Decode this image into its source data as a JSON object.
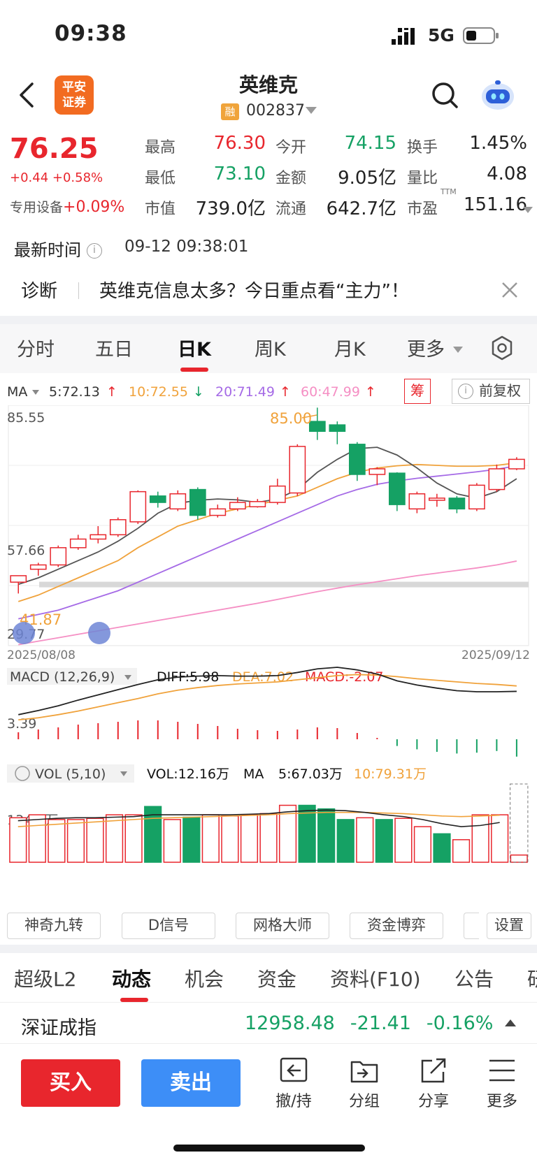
{
  "status": {
    "time": "09:38",
    "network": "5G"
  },
  "header": {
    "logo_line1": "平安",
    "logo_line2": "证券",
    "name": "英维克",
    "badge": "融",
    "code": "002837"
  },
  "quote": {
    "price": "76.25",
    "change": "+0.44 +0.58%",
    "sector": "专用设备",
    "sector_change": "+0.09%",
    "high_label": "最高",
    "high": "76.30",
    "open_label": "今开",
    "open": "74.15",
    "turnover_label": "换手",
    "turnover": "1.45%",
    "low_label": "最低",
    "low": "73.10",
    "amount_label": "金额",
    "amount": "9.05亿",
    "vol_ratio_label": "量比",
    "vol_ratio": "4.08",
    "mktcap_label": "市值",
    "mktcap": "739.0亿",
    "float_label": "流通",
    "float": "642.7亿",
    "pe_label": "市盈",
    "pe_mark": "TTM",
    "pe": "151.16"
  },
  "update": {
    "label": "最新时间",
    "time": "09-12 09:38:01"
  },
  "diagnosis": {
    "label": "诊断",
    "text": "英维克信息太多？今日重点看“主力”！"
  },
  "period_tabs": [
    "分时",
    "五日",
    "日K",
    "周K",
    "月K",
    "更多"
  ],
  "ma_bar": {
    "label": "MA",
    "ma5": "5:72.13",
    "ma10": "10:72.55",
    "ma20": "20:71.49",
    "ma60": "60:47.99",
    "chip_label": "筹",
    "adjust_label": "前复权"
  },
  "chart_data": {
    "type": "candlestick",
    "y_labels": [
      "85.55",
      "57.66",
      "29.77"
    ],
    "high_annotation": "85.00",
    "low_annotation": "41.87",
    "x_start": "2025/08/08",
    "x_end": "2025/09/12",
    "ylim": [
      29.77,
      85.55
    ],
    "candles": [
      [
        44.5,
        46.0,
        41.87,
        42.5
      ],
      [
        47.5,
        48.5,
        46.0,
        49.0
      ],
      [
        48.5,
        52.5,
        48.0,
        53.0
      ],
      [
        52.5,
        54.5,
        52.0,
        55.5
      ],
      [
        54.5,
        55.5,
        53.5,
        57.5
      ],
      [
        55.5,
        59.0,
        55.0,
        59.5
      ],
      [
        58.5,
        65.5,
        58.0,
        65.8
      ],
      [
        64.5,
        63.0,
        61.8,
        65.5
      ],
      [
        61.5,
        65.0,
        61.0,
        65.8
      ],
      [
        66.0,
        60.0,
        59.0,
        66.5
      ],
      [
        60.0,
        61.5,
        59.5,
        62.5
      ],
      [
        61.5,
        63.0,
        61.0,
        64.2
      ],
      [
        62.0,
        63.2,
        61.8,
        63.8
      ],
      [
        63.0,
        66.8,
        62.5,
        68.5
      ],
      [
        65.2,
        76.0,
        64.5,
        76.5
      ],
      [
        81.8,
        79.5,
        77.5,
        85.0
      ],
      [
        81.0,
        79.5,
        76.5,
        81.8
      ],
      [
        76.5,
        69.5,
        68.0,
        77.0
      ],
      [
        69.5,
        70.8,
        67.0,
        71.2
      ],
      [
        69.8,
        62.5,
        61.0,
        70.0
      ],
      [
        61.5,
        65.0,
        60.5,
        65.5
      ],
      [
        63.5,
        64.0,
        62.0,
        65.0
      ],
      [
        64.0,
        61.5,
        60.5,
        64.5
      ],
      [
        61.5,
        67.0,
        61.0,
        67.5
      ],
      [
        66.0,
        70.8,
        65.5,
        71.8
      ],
      [
        70.8,
        73.0,
        70.5,
        73.5
      ]
    ],
    "ma5": [
      44.0,
      45.5,
      47.5,
      49.5,
      51.5,
      54.0,
      57.0,
      60.5,
      62.8,
      63.5,
      63.8,
      63.6,
      63.0,
      63.8,
      66.0,
      70.0,
      73.0,
      75.5,
      75.8,
      74.0,
      71.0,
      67.5,
      65.0,
      64.0,
      65.5,
      68.5
    ],
    "ma10": [
      40.0,
      41.5,
      43.5,
      45.5,
      47.5,
      49.5,
      52.5,
      55.0,
      57.5,
      59.0,
      60.5,
      61.5,
      62.5,
      63.5,
      64.5,
      66.5,
      68.5,
      70.0,
      71.0,
      71.5,
      71.8,
      71.6,
      71.4,
      71.4,
      71.6,
      72.2
    ],
    "ma20": [
      36.0,
      37.0,
      38.0,
      39.5,
      41.0,
      42.5,
      44.5,
      46.5,
      48.5,
      50.5,
      52.5,
      54.5,
      56.5,
      58.5,
      60.5,
      62.5,
      64.5,
      66.0,
      67.2,
      68.0,
      68.6,
      69.1,
      69.6,
      70.1,
      70.7,
      71.5
    ],
    "ma60": [
      30.0,
      30.8,
      31.6,
      32.4,
      33.2,
      34.0,
      34.8,
      35.6,
      36.4,
      37.2,
      38.0,
      38.8,
      39.6,
      40.5,
      41.4,
      42.3,
      43.1,
      43.9,
      44.6,
      45.3,
      46.0,
      46.6,
      47.2,
      47.8,
      48.5,
      49.4
    ],
    "macd": {
      "label": "MACD (12,26,9)",
      "diff_label": "DIFF:5.98",
      "dea_label": "DEA:7.02",
      "macd_label": "MACD:-2.07",
      "y_label": "3.39",
      "diff": [
        1.5,
        2.3,
        3.2,
        4.3,
        5.3,
        6.3,
        7.3,
        8.2,
        8.7,
        8.9,
        9.0,
        8.9,
        8.9,
        9.0,
        9.6,
        10.3,
        10.6,
        10.1,
        9.3,
        8.0,
        7.2,
        6.6,
        6.1,
        5.9,
        5.9,
        5.98
      ],
      "dea": [
        0.5,
        0.9,
        1.5,
        2.2,
        3.0,
        3.8,
        4.6,
        5.5,
        6.2,
        6.7,
        7.1,
        7.4,
        7.6,
        7.8,
        8.2,
        8.6,
        9.0,
        9.2,
        9.1,
        8.8,
        8.4,
        8.1,
        7.8,
        7.5,
        7.3,
        7.02
      ],
      "hist": [
        1.0,
        1.4,
        1.7,
        2.1,
        2.3,
        2.5,
        2.7,
        2.7,
        2.5,
        2.2,
        1.9,
        1.5,
        1.3,
        1.2,
        1.4,
        1.7,
        1.6,
        0.9,
        0.2,
        -0.8,
        -1.2,
        -1.5,
        -1.7,
        -1.6,
        -1.4,
        -2.07
      ]
    },
    "volume": {
      "label": "VOL (5,10)",
      "vol_label": "VOL:12.16万",
      "ma_label": "MA",
      "ma5_label": "5:67.03万",
      "ma10_label": "10:79.31万",
      "y_label": "134.3万",
      "values": [
        75,
        80,
        72,
        72,
        74,
        80,
        80,
        94,
        72,
        76,
        80,
        78,
        80,
        82,
        96,
        96,
        90,
        72,
        75,
        72,
        74,
        60,
        48,
        38,
        80,
        80,
        12.16
      ],
      "ma5": [
        70,
        72,
        74,
        75,
        75,
        76,
        77,
        80,
        80,
        80,
        80,
        80,
        81,
        82,
        85,
        87,
        88,
        87,
        84,
        80,
        77,
        72,
        65,
        60,
        62,
        67
      ],
      "ma10": [
        60,
        62,
        64,
        66,
        68,
        70,
        72,
        74,
        75,
        76,
        77,
        78,
        79,
        80,
        82,
        83,
        84,
        84,
        84,
        83,
        82,
        80,
        78,
        77,
        78,
        79.31
      ]
    }
  },
  "indicator_buttons": [
    "神奇九转",
    "D信号",
    "网格大师",
    "资金博弈",
    "设置"
  ],
  "info_tabs": [
    "超级L2",
    "动态",
    "机会",
    "资金",
    "资料(F10)",
    "公告",
    "研"
  ],
  "index": {
    "name": "深证成指",
    "value": "12958.48",
    "change": "-21.41",
    "percent": "-0.16%"
  },
  "actions": {
    "buy": "买入",
    "sell": "卖出",
    "cancel": "撤/持",
    "group": "分组",
    "share": "分享",
    "more": "更多"
  },
  "colors": {
    "up": "#e8262d",
    "down": "#15a164",
    "ma5": "#555555",
    "ma10": "#f0a23b",
    "ma20": "#a56ae6",
    "ma60": "#f58fc4"
  }
}
